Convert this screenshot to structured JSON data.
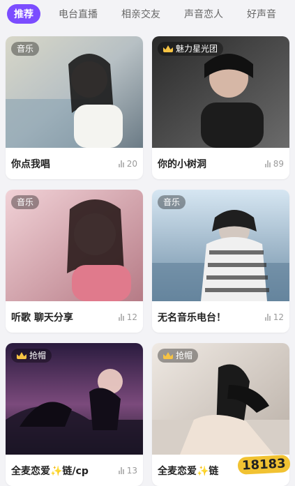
{
  "tabs": [
    {
      "label": "推荐",
      "active": true
    },
    {
      "label": "电台直播",
      "active": false
    },
    {
      "label": "相亲交友",
      "active": false
    },
    {
      "label": "声音恋人",
      "active": false
    },
    {
      "label": "好声音",
      "active": false
    }
  ],
  "cards": [
    {
      "badge": "音乐",
      "badge_type": "tag",
      "title": "你点我唱",
      "listeners": "20"
    },
    {
      "badge": "魅力星光团",
      "badge_type": "crown",
      "title": "你的小树洞",
      "listeners": "89"
    },
    {
      "badge": "音乐",
      "badge_type": "tag",
      "title": "听歌 聊天分享",
      "listeners": "12"
    },
    {
      "badge": "音乐",
      "badge_type": "tag",
      "title": "无名音乐电台！",
      "listeners": "12"
    },
    {
      "badge": "抢帽",
      "badge_type": "crown",
      "title": "全麦恋爱✨链/cp",
      "listeners": "13"
    },
    {
      "badge": "抢帽",
      "badge_type": "crown",
      "title": "全麦恋爱✨链",
      "listeners": ""
    }
  ],
  "watermark": "18183",
  "colors": {
    "accent": "#7b4cff",
    "bg": "#f3f3f6",
    "text": "#222222",
    "muted": "#9a9a9a"
  }
}
